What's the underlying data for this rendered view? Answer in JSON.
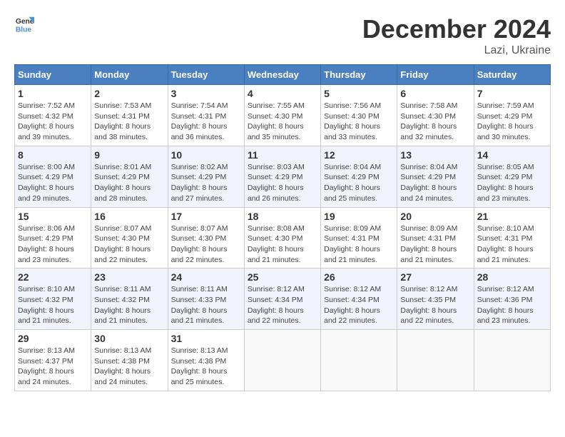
{
  "header": {
    "logo_general": "General",
    "logo_blue": "Blue",
    "month_title": "December 2024",
    "location": "Lazi, Ukraine"
  },
  "weekdays": [
    "Sunday",
    "Monday",
    "Tuesday",
    "Wednesday",
    "Thursday",
    "Friday",
    "Saturday"
  ],
  "weeks": [
    [
      {
        "day": "1",
        "sunrise": "7:52 AM",
        "sunset": "4:32 PM",
        "daylight": "8 hours and 39 minutes."
      },
      {
        "day": "2",
        "sunrise": "7:53 AM",
        "sunset": "4:31 PM",
        "daylight": "8 hours and 38 minutes."
      },
      {
        "day": "3",
        "sunrise": "7:54 AM",
        "sunset": "4:31 PM",
        "daylight": "8 hours and 36 minutes."
      },
      {
        "day": "4",
        "sunrise": "7:55 AM",
        "sunset": "4:30 PM",
        "daylight": "8 hours and 35 minutes."
      },
      {
        "day": "5",
        "sunrise": "7:56 AM",
        "sunset": "4:30 PM",
        "daylight": "8 hours and 33 minutes."
      },
      {
        "day": "6",
        "sunrise": "7:58 AM",
        "sunset": "4:30 PM",
        "daylight": "8 hours and 32 minutes."
      },
      {
        "day": "7",
        "sunrise": "7:59 AM",
        "sunset": "4:29 PM",
        "daylight": "8 hours and 30 minutes."
      }
    ],
    [
      {
        "day": "8",
        "sunrise": "8:00 AM",
        "sunset": "4:29 PM",
        "daylight": "8 hours and 29 minutes."
      },
      {
        "day": "9",
        "sunrise": "8:01 AM",
        "sunset": "4:29 PM",
        "daylight": "8 hours and 28 minutes."
      },
      {
        "day": "10",
        "sunrise": "8:02 AM",
        "sunset": "4:29 PM",
        "daylight": "8 hours and 27 minutes."
      },
      {
        "day": "11",
        "sunrise": "8:03 AM",
        "sunset": "4:29 PM",
        "daylight": "8 hours and 26 minutes."
      },
      {
        "day": "12",
        "sunrise": "8:04 AM",
        "sunset": "4:29 PM",
        "daylight": "8 hours and 25 minutes."
      },
      {
        "day": "13",
        "sunrise": "8:04 AM",
        "sunset": "4:29 PM",
        "daylight": "8 hours and 24 minutes."
      },
      {
        "day": "14",
        "sunrise": "8:05 AM",
        "sunset": "4:29 PM",
        "daylight": "8 hours and 23 minutes."
      }
    ],
    [
      {
        "day": "15",
        "sunrise": "8:06 AM",
        "sunset": "4:29 PM",
        "daylight": "8 hours and 23 minutes."
      },
      {
        "day": "16",
        "sunrise": "8:07 AM",
        "sunset": "4:30 PM",
        "daylight": "8 hours and 22 minutes."
      },
      {
        "day": "17",
        "sunrise": "8:07 AM",
        "sunset": "4:30 PM",
        "daylight": "8 hours and 22 minutes."
      },
      {
        "day": "18",
        "sunrise": "8:08 AM",
        "sunset": "4:30 PM",
        "daylight": "8 hours and 21 minutes."
      },
      {
        "day": "19",
        "sunrise": "8:09 AM",
        "sunset": "4:31 PM",
        "daylight": "8 hours and 21 minutes."
      },
      {
        "day": "20",
        "sunrise": "8:09 AM",
        "sunset": "4:31 PM",
        "daylight": "8 hours and 21 minutes."
      },
      {
        "day": "21",
        "sunrise": "8:10 AM",
        "sunset": "4:31 PM",
        "daylight": "8 hours and 21 minutes."
      }
    ],
    [
      {
        "day": "22",
        "sunrise": "8:10 AM",
        "sunset": "4:32 PM",
        "daylight": "8 hours and 21 minutes."
      },
      {
        "day": "23",
        "sunrise": "8:11 AM",
        "sunset": "4:32 PM",
        "daylight": "8 hours and 21 minutes."
      },
      {
        "day": "24",
        "sunrise": "8:11 AM",
        "sunset": "4:33 PM",
        "daylight": "8 hours and 21 minutes."
      },
      {
        "day": "25",
        "sunrise": "8:12 AM",
        "sunset": "4:34 PM",
        "daylight": "8 hours and 22 minutes."
      },
      {
        "day": "26",
        "sunrise": "8:12 AM",
        "sunset": "4:34 PM",
        "daylight": "8 hours and 22 minutes."
      },
      {
        "day": "27",
        "sunrise": "8:12 AM",
        "sunset": "4:35 PM",
        "daylight": "8 hours and 22 minutes."
      },
      {
        "day": "28",
        "sunrise": "8:12 AM",
        "sunset": "4:36 PM",
        "daylight": "8 hours and 23 minutes."
      }
    ],
    [
      {
        "day": "29",
        "sunrise": "8:13 AM",
        "sunset": "4:37 PM",
        "daylight": "8 hours and 24 minutes."
      },
      {
        "day": "30",
        "sunrise": "8:13 AM",
        "sunset": "4:38 PM",
        "daylight": "8 hours and 24 minutes."
      },
      {
        "day": "31",
        "sunrise": "8:13 AM",
        "sunset": "4:38 PM",
        "daylight": "8 hours and 25 minutes."
      },
      null,
      null,
      null,
      null
    ]
  ],
  "labels": {
    "sunrise": "Sunrise:",
    "sunset": "Sunset:",
    "daylight": "Daylight:"
  }
}
